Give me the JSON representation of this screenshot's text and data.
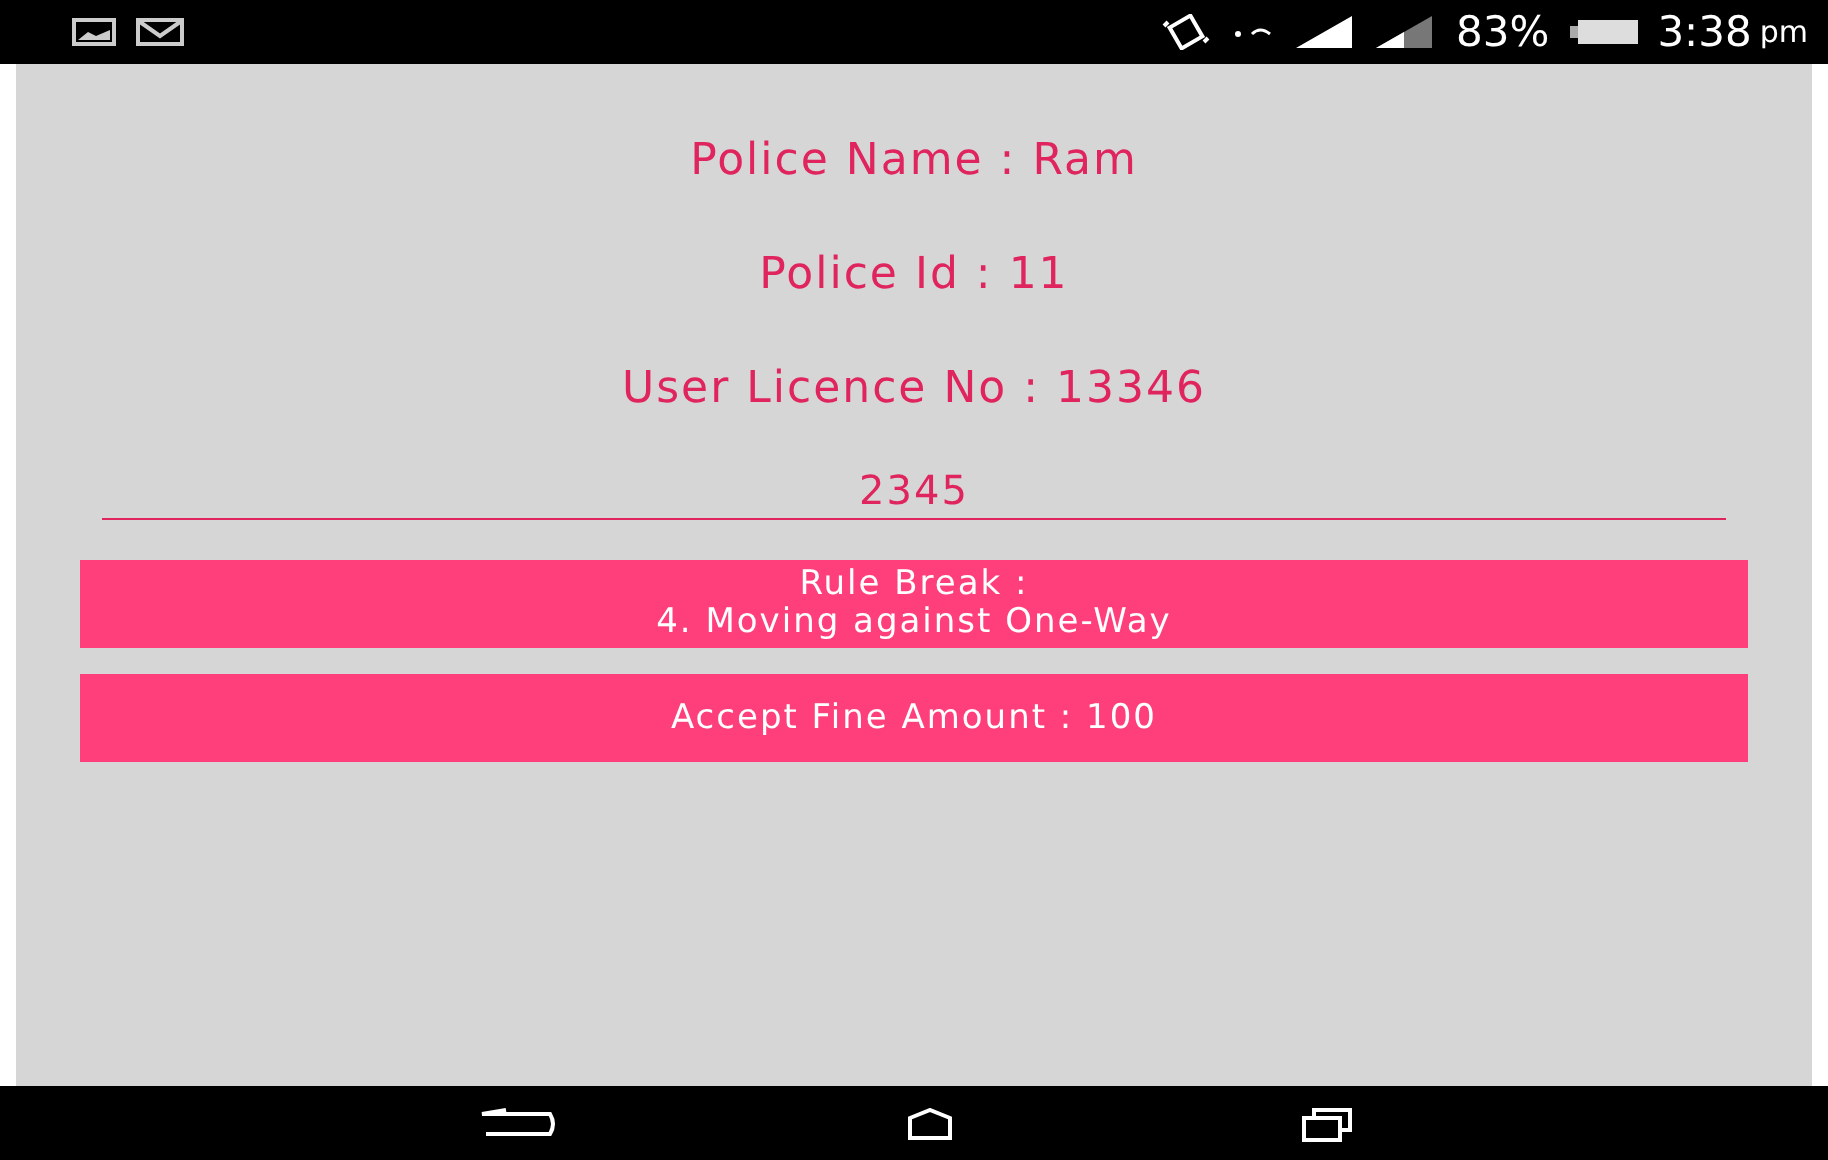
{
  "status_bar": {
    "battery": "83%",
    "time": "3:38",
    "ampm": "pm"
  },
  "info_lines": [
    "Police Name : Ram",
    "Police Id : 11",
    "User Licence No : 13346"
  ],
  "amount_field": {
    "value": "2345"
  },
  "buttons": [
    "Rule Break :\n4. Moving against One-Way",
    "Accept Fine Amount : 100"
  ]
}
